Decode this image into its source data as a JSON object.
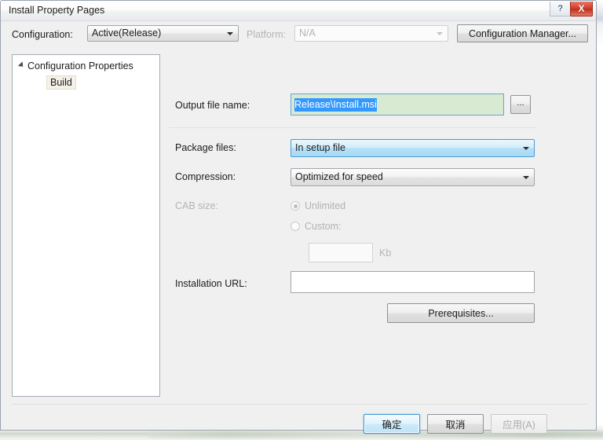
{
  "window": {
    "title": "Install Property Pages",
    "help_label": "?",
    "close_label": "X"
  },
  "config_bar": {
    "configuration_label": "Configuration:",
    "configuration_value": "Active(Release)",
    "platform_label": "Platform:",
    "platform_value": "N/A",
    "configuration_manager_label": "Configuration Manager..."
  },
  "tree": {
    "root_label": "Configuration Properties",
    "child_label": "Build"
  },
  "form": {
    "output_file_label": "Output file name:",
    "output_file_value": "Release\\Install.msi",
    "browse_label": "...",
    "package_files_label": "Package files:",
    "package_files_value": "In setup file",
    "compression_label": "Compression:",
    "compression_value": "Optimized for speed",
    "cab_size_label": "CAB size:",
    "cab_unlimited_label": "Unlimited",
    "cab_custom_label": "Custom:",
    "cab_custom_value": "",
    "cab_units_label": "Kb",
    "installation_url_label": "Installation URL:",
    "installation_url_value": "",
    "prerequisites_label": "Prerequisites..."
  },
  "footer": {
    "ok_label": "确定",
    "cancel_label": "取消",
    "apply_label": "应用(A)"
  },
  "colors": {
    "accent": "#3399ff",
    "focus_field_bg": "#d9ead3",
    "close_red": "#c02e1b",
    "default_button_border": "#3c9ad6"
  }
}
